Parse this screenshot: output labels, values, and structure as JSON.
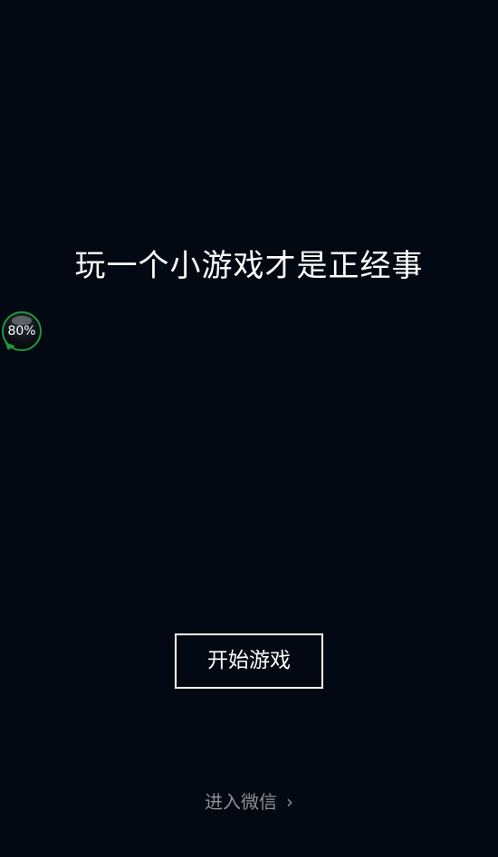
{
  "headline": "玩一个小游戏才是正经事",
  "floating_badge": {
    "percent_label": "80%",
    "ring_color": "#1e9a3a"
  },
  "start_button": {
    "label": "开始游戏"
  },
  "wechat_link": {
    "label": "进入微信",
    "icon": "chevron-right-icon",
    "icon_glyph": "›"
  },
  "colors": {
    "background": "#020912",
    "text": "#ffffff",
    "muted_text": "#8b8f96"
  }
}
